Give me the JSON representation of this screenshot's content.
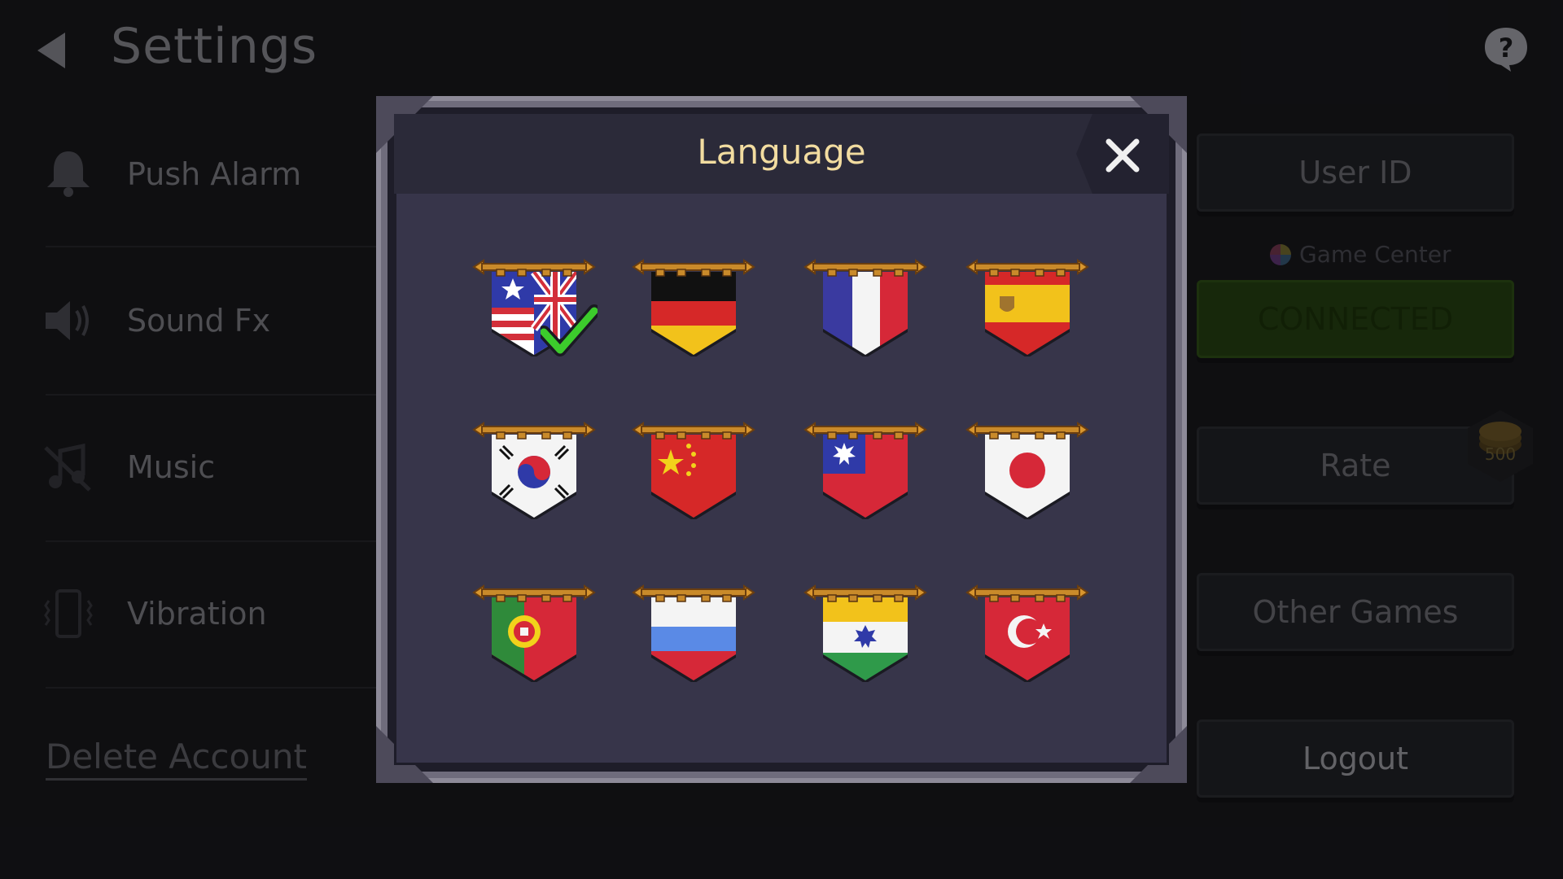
{
  "header": {
    "title": "Settings"
  },
  "settings": [
    {
      "label": "Push Alarm",
      "icon": "bell-icon"
    },
    {
      "label": "Sound Fx",
      "icon": "speaker-icon"
    },
    {
      "label": "Music",
      "icon": "music-muted-icon"
    },
    {
      "label": "Vibration",
      "icon": "vibration-icon"
    }
  ],
  "delete_account": "Delete Account",
  "side_buttons": {
    "user_id": "User ID",
    "game_center": "Game Center",
    "connected": "CONNECTED",
    "rate": "Rate",
    "rate_reward": "500",
    "other_games": "Other Games",
    "logout": "Logout"
  },
  "modal": {
    "title": "Language",
    "close_icon": "close-icon",
    "selected": "en",
    "languages": [
      {
        "code": "en",
        "flag": "us-uk-flag"
      },
      {
        "code": "de",
        "flag": "germany-flag"
      },
      {
        "code": "fr",
        "flag": "france-flag"
      },
      {
        "code": "es",
        "flag": "spain-flag"
      },
      {
        "code": "ko",
        "flag": "south-korea-flag"
      },
      {
        "code": "zh-cn",
        "flag": "china-flag"
      },
      {
        "code": "zh-tw",
        "flag": "taiwan-flag"
      },
      {
        "code": "ja",
        "flag": "japan-flag"
      },
      {
        "code": "pt",
        "flag": "portugal-flag"
      },
      {
        "code": "ru",
        "flag": "russia-flag"
      },
      {
        "code": "hi",
        "flag": "india-flag"
      },
      {
        "code": "tr",
        "flag": "turkey-flag"
      }
    ]
  },
  "colors": {
    "modal_title": "#f2dca0",
    "connected_green": "#2b4a14",
    "check_green": "#3ccb2c",
    "rod_gold": "#c98a2a"
  }
}
